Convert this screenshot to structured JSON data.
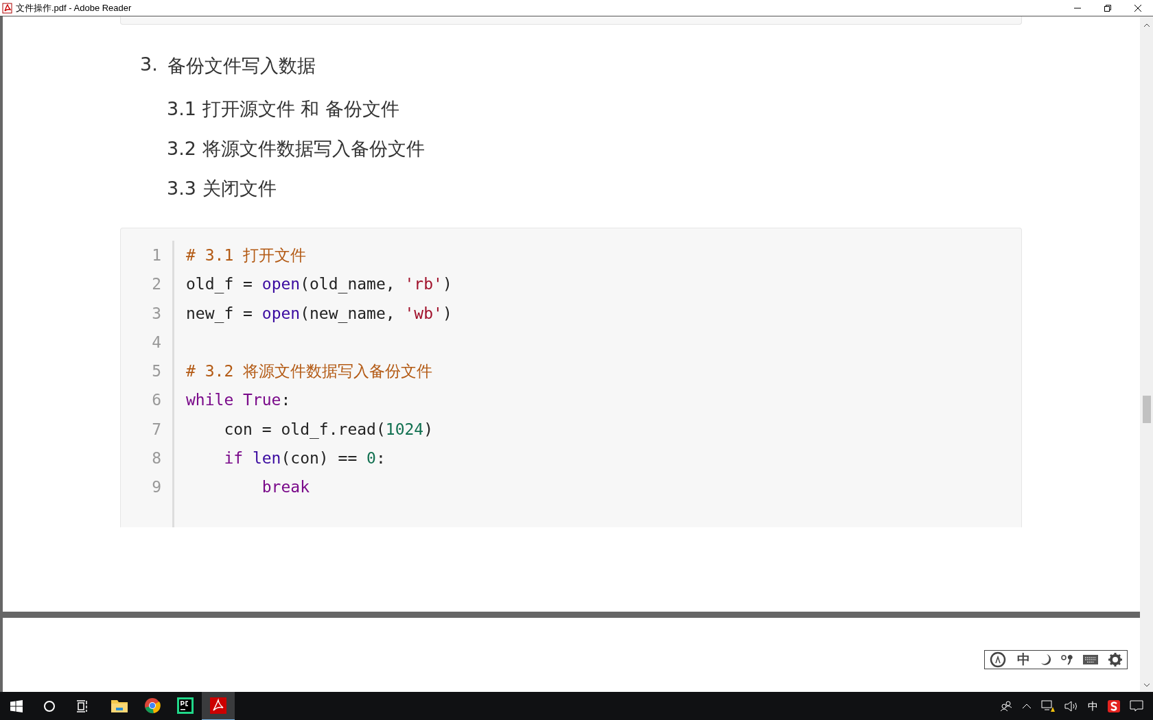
{
  "window": {
    "title": "文件操作.pdf - Adobe Reader"
  },
  "document": {
    "heading": {
      "number": "3.",
      "text": "备份文件写入数据"
    },
    "subitems": [
      "3.1 打开源文件 和 备份文件",
      "3.2 将源文件数据写入备份文件",
      "3.3 关闭文件"
    ],
    "code": [
      {
        "number": "1",
        "kind": "top",
        "tokens": [
          {
            "kind": "comment",
            "text": "# 3.1 打开文件"
          }
        ]
      },
      {
        "number": "2",
        "kind": "top",
        "tokens": [
          {
            "kind": "plain",
            "text": "old_f = "
          },
          {
            "kind": "builtin",
            "text": "open"
          },
          {
            "kind": "plain",
            "text": "(old_name, "
          },
          {
            "kind": "string",
            "text": "'rb'"
          },
          {
            "kind": "plain",
            "text": ")"
          }
        ]
      },
      {
        "number": "3",
        "kind": "top",
        "tokens": [
          {
            "kind": "plain",
            "text": "new_f = "
          },
          {
            "kind": "builtin",
            "text": "open"
          },
          {
            "kind": "plain",
            "text": "(new_name, "
          },
          {
            "kind": "string",
            "text": "'wb'"
          },
          {
            "kind": "plain",
            "text": ")"
          }
        ]
      },
      {
        "number": "4",
        "kind": "blank"
      },
      {
        "number": "5",
        "kind": "top",
        "tokens": [
          {
            "kind": "comment",
            "text": "# 3.2 将源文件数据写入备份文件"
          }
        ]
      },
      {
        "number": "6",
        "kind": "top",
        "tokens": [
          {
            "kind": "keyword",
            "text": "while True"
          },
          {
            "kind": "plain",
            "text": ":"
          }
        ]
      },
      {
        "number": "7",
        "kind": "block",
        "tokens": [
          {
            "kind": "plain",
            "text": "con = old_f.read("
          },
          {
            "kind": "number",
            "text": "1024"
          },
          {
            "kind": "plain",
            "text": ")"
          }
        ]
      },
      {
        "number": "8",
        "kind": "block",
        "tokens": [
          {
            "kind": "keyword",
            "text": "if"
          },
          {
            "kind": "builtin",
            "text": " len"
          },
          {
            "kind": "plain",
            "text": "(con) == "
          },
          {
            "kind": "number",
            "text": "0"
          },
          {
            "kind": "plain",
            "text": ":"
          }
        ]
      },
      {
        "number": "9",
        "kind": "inner",
        "tokens": [
          {
            "kind": "keyword",
            "text": "break"
          }
        ]
      }
    ]
  },
  "ime_toolbar": {
    "mode": "中"
  },
  "taskbar": {
    "apps": [
      {
        "kind": "explorer",
        "selected": false
      },
      {
        "kind": "chrome",
        "selected": false
      },
      {
        "kind": "pycharm",
        "selected": false
      },
      {
        "kind": "acrobat",
        "selected": true
      }
    ],
    "tray_language": "中"
  }
}
